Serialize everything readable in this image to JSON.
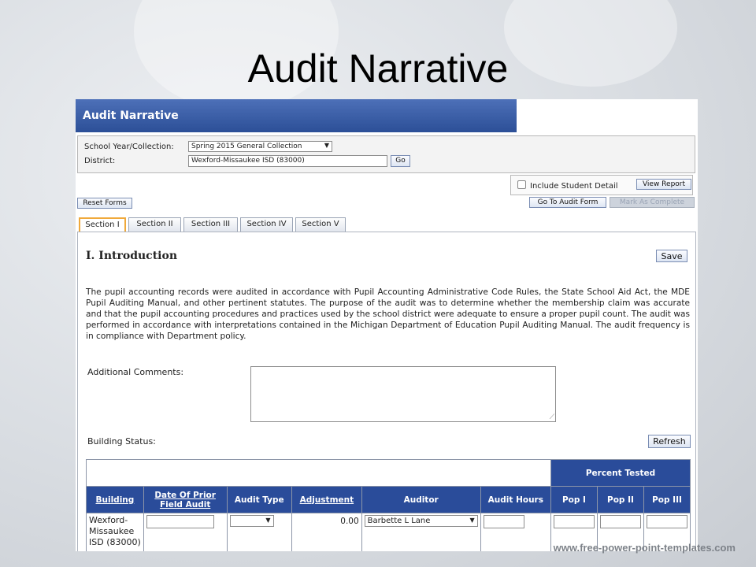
{
  "slide": {
    "title": "Audit Narrative",
    "watermark": "www.free-power-point-templates.com"
  },
  "app": {
    "header_title": "Audit Narrative",
    "filters": {
      "school_year_label": "School Year/Collection:",
      "school_year_value": "Spring 2015 General Collection",
      "district_label": "District:",
      "district_value": "Wexford-Missaukee ISD (83000)",
      "go_label": "Go"
    },
    "toolbar": {
      "include_student_detail_label": "Include Student Detail",
      "include_student_detail_checked": false,
      "view_report_label": "View Report",
      "go_to_audit_form_label": "Go To Audit Form",
      "audit_complete_label": "Mark As Complete",
      "reset_forms_label": "Reset Forms"
    },
    "tabs": [
      {
        "label": "Section I",
        "active": true
      },
      {
        "label": "Section II",
        "active": false
      },
      {
        "label": "Section III",
        "active": false
      },
      {
        "label": "Section IV",
        "active": false
      },
      {
        "label": "Section V",
        "active": false
      }
    ],
    "section": {
      "title": "I. Introduction",
      "save_label": "Save",
      "body": "The pupil accounting records were audited in accordance with Pupil Accounting Administrative Code Rules, the State School Aid Act, the MDE Pupil Auditing Manual, and other pertinent statutes. The purpose of the audit was to determine whether the membership claim was accurate and that the pupil accounting procedures and practices used by the school district were adequate to ensure a proper pupil count. The audit was performed in accordance with interpretations contained in the Michigan Department of Education Pupil Auditing Manual. The audit frequency is in compliance with Department policy.",
      "additional_comments_label": "Additional Comments:",
      "additional_comments_value": "",
      "building_status_label": "Building Status:",
      "refresh_label": "Refresh"
    },
    "building_table": {
      "group_header": "Percent Tested",
      "columns": [
        "Building",
        "Date Of Prior Field Audit",
        "Audit Type",
        "Adjustment",
        "Auditor",
        "Audit Hours",
        "Pop I",
        "Pop II",
        "Pop III"
      ],
      "rows": [
        {
          "building": "Wexford-Missaukee ISD (83000)",
          "date_of_prior_field_audit": "",
          "audit_type": "",
          "adjustment": "0.00",
          "auditor": "Barbette L Lane",
          "audit_hours": "",
          "pop_i": "",
          "pop_ii": "",
          "pop_iii": ""
        }
      ]
    }
  }
}
